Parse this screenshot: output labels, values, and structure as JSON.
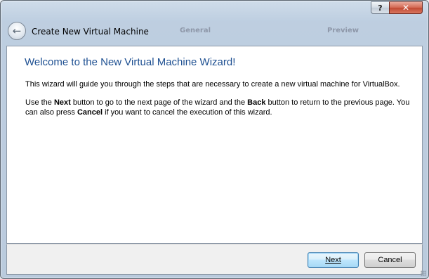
{
  "window": {
    "help_label": "?",
    "close_label": "✕",
    "title": "Create New Virtual Machine",
    "back_glyph": "←",
    "background_tabs": [
      "General",
      "Preview"
    ]
  },
  "page": {
    "heading": "Welcome to the New Virtual Machine Wizard!",
    "intro": "This wizard will guide you through the steps that are necessary to create a new virtual machine for VirtualBox.",
    "instr_use_the": "Use the ",
    "instr_next_word": "Next",
    "instr_mid1": " button to go to the next page of the wizard and the ",
    "instr_back_word": "Back",
    "instr_mid2": " button to return to the previous page. You can also press ",
    "instr_cancel_word": "Cancel",
    "instr_end": " if you want to cancel the execution of this wizard."
  },
  "footer": {
    "next_label": "Next",
    "cancel_label": "Cancel"
  },
  "colors": {
    "heading": "#1d4f91",
    "close_button": "#c14a33"
  }
}
